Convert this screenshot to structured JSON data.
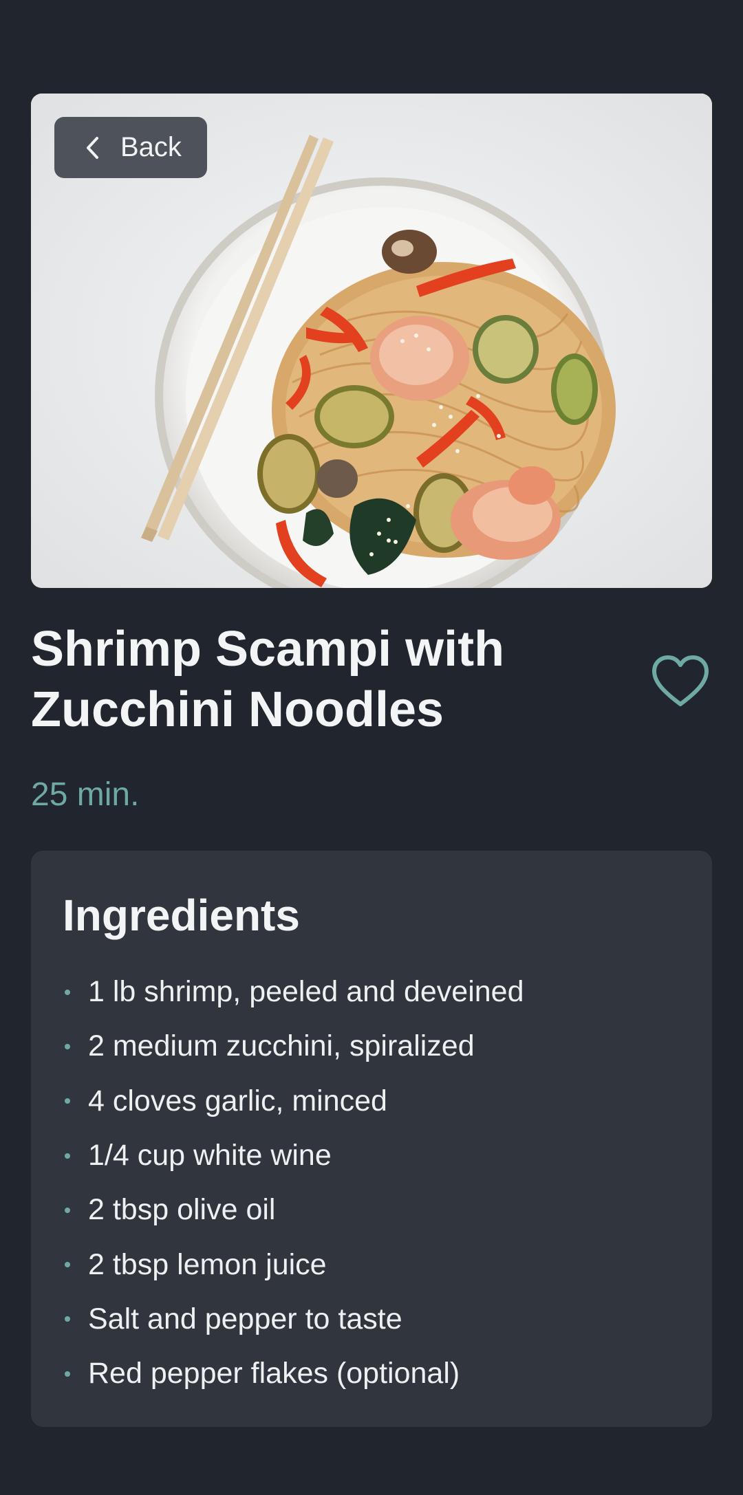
{
  "hero": {
    "back_label": "Back",
    "image_description": "plate of noodles with shrimp, zucchini, peppers and chopsticks"
  },
  "recipe": {
    "title_line1": "Shrimp Scampi with",
    "title_line2": "Zucchini Noodles",
    "time": "25 min."
  },
  "ingredients": {
    "heading": "Ingredients",
    "items": [
      "1 lb shrimp, peeled and deveined",
      "2 medium zucchini, spiralized",
      "4 cloves garlic, minced",
      "1/4 cup white wine",
      "2 tbsp olive oil",
      "2 tbsp lemon juice",
      "Salt and pepper to taste",
      "Red pepper flakes (optional)"
    ]
  },
  "colors": {
    "background": "#21252e",
    "card": "#31353e",
    "accent": "#6fa9a4",
    "text": "#f2f4f5"
  },
  "icons": {
    "back": "chevron-left-icon",
    "favorite": "heart-outline-icon"
  }
}
